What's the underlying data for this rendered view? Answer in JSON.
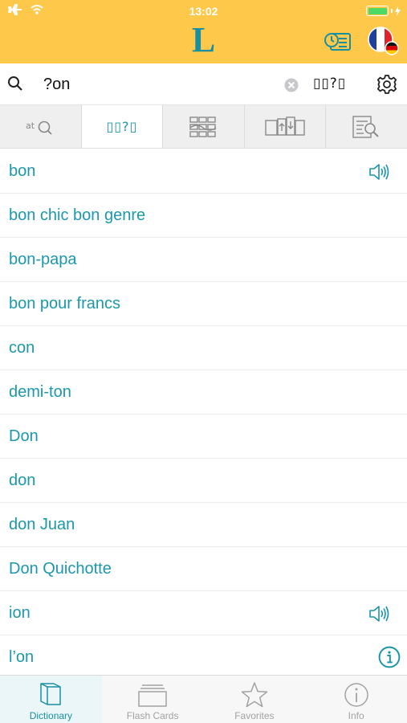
{
  "status": {
    "time": "13:02",
    "battery_level": 1.0
  },
  "app": {
    "logo": "L"
  },
  "search": {
    "query": "?on",
    "wildcard_label": "▯▯?▯"
  },
  "modes": [
    {
      "name": "spell-suggest",
      "label": "at",
      "icon": "magnifier-icon"
    },
    {
      "name": "wildcard",
      "label": "▯▯?▯",
      "icon": "wildcard-icon"
    },
    {
      "name": "fulltext",
      "icon": "grid-icon"
    },
    {
      "name": "translate",
      "icon": "translate-icon"
    },
    {
      "name": "document-search",
      "icon": "document-search-icon"
    }
  ],
  "results": [
    {
      "word": "bon",
      "icon": "speaker-icon"
    },
    {
      "word": "bon chic bon genre"
    },
    {
      "word": "bon-papa"
    },
    {
      "word": "bon pour francs"
    },
    {
      "word": "con"
    },
    {
      "word": "demi-ton"
    },
    {
      "word": "Don"
    },
    {
      "word": "don"
    },
    {
      "word": "don Juan"
    },
    {
      "word": "Don Quichotte"
    },
    {
      "word": "ion",
      "icon": "speaker-icon"
    },
    {
      "word": "l’on",
      "icon": "info-icon"
    }
  ],
  "tabs": [
    {
      "label": "Dictionary",
      "active": true
    },
    {
      "label": "Flash Cards"
    },
    {
      "label": "Favorites"
    },
    {
      "label": "Info"
    }
  ],
  "colors": {
    "header": "#fec94a",
    "accent": "#1a95a8",
    "battery": "#4cd964"
  }
}
